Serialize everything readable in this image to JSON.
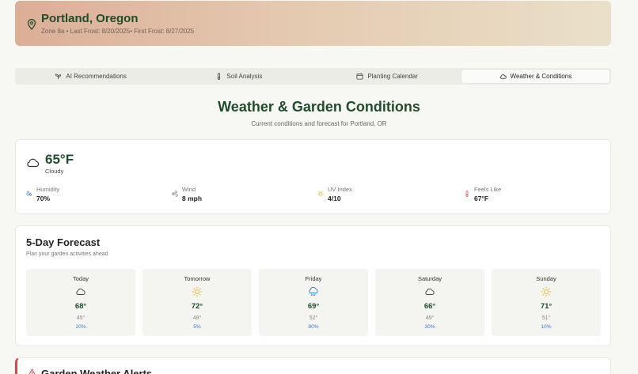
{
  "location": {
    "title": "Portland, Oregon",
    "subtitle": "Zone 8a • Last Frost: 8/20/2025• First Frost: 8/27/2025"
  },
  "tabs": [
    {
      "label": "AI Recommendations",
      "icon": "sprout-icon"
    },
    {
      "label": "Soil Analysis",
      "icon": "thermometer-icon"
    },
    {
      "label": "Planting Calendar",
      "icon": "calendar-icon"
    },
    {
      "label": "Weather & Conditions",
      "icon": "cloud-icon",
      "active": true
    }
  ],
  "section": {
    "title": "Weather & Garden Conditions",
    "subtitle": "Current conditions and forecast for Portland, OR"
  },
  "current": {
    "temp": "65°F",
    "condition": "Cloudy",
    "stats": [
      {
        "label": "Humidity",
        "value": "70%",
        "icon": "droplets-icon"
      },
      {
        "label": "Wind",
        "value": "8 mph",
        "icon": "wind-icon"
      },
      {
        "label": "UV Index",
        "value": "4/10",
        "icon": "sun-icon"
      },
      {
        "label": "Feels Like",
        "value": "67°F",
        "icon": "thermometer-icon"
      }
    ]
  },
  "forecast": {
    "title": "5-Day Forecast",
    "subtitle": "Plan your garden activities ahead",
    "days": [
      {
        "name": "Today",
        "icon": "cloud-icon",
        "high": "68°",
        "low": "45°",
        "precip": "20%"
      },
      {
        "name": "Tomorrow",
        "icon": "sun-icon",
        "high": "72°",
        "low": "48°",
        "precip": "5%"
      },
      {
        "name": "Friday",
        "icon": "rain-cloud-icon",
        "high": "69°",
        "low": "52°",
        "precip": "80%"
      },
      {
        "name": "Saturday",
        "icon": "cloud-icon",
        "high": "66°",
        "low": "49°",
        "precip": "30%"
      },
      {
        "name": "Sunday",
        "icon": "sun-icon",
        "high": "71°",
        "low": "51°",
        "precip": "10%"
      }
    ]
  },
  "alerts": {
    "title": "Garden Weather Alerts"
  },
  "colors": {
    "brand_green": "#1f4d2c",
    "sun_yellow": "#e8b923",
    "precip_blue": "#3a7bd5",
    "alert_red": "#d84a4a"
  }
}
